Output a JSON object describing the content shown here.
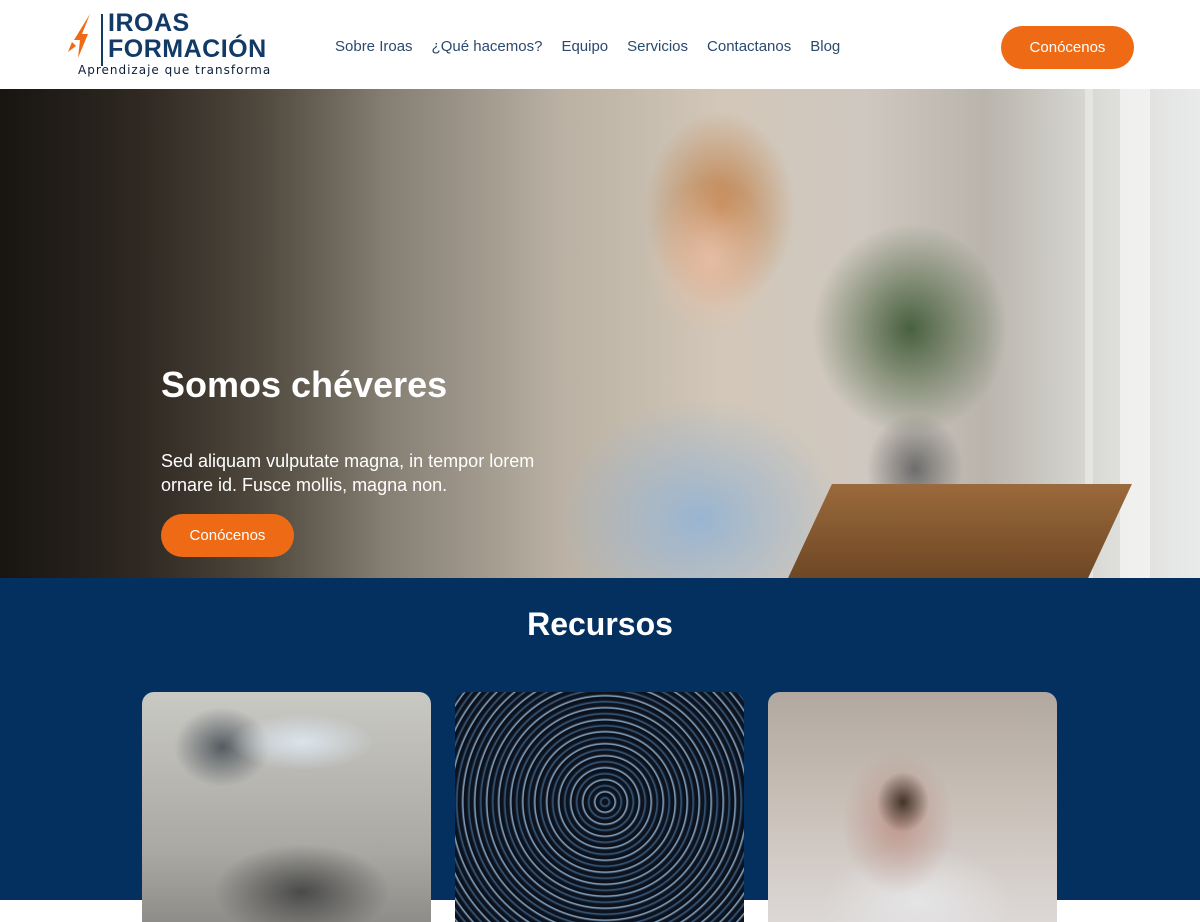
{
  "brand": {
    "line1": "IROAS",
    "line2": "FORMACIÓN",
    "tagline": "Aprendizaje que transforma",
    "accent_color": "#ee6a14",
    "primary_color": "#123a66"
  },
  "nav": {
    "items": [
      {
        "label": "Sobre Iroas"
      },
      {
        "label": "¿Qué hacemos?"
      },
      {
        "label": "Equipo"
      },
      {
        "label": "Servicios"
      },
      {
        "label": "Contactanos"
      },
      {
        "label": "Blog"
      }
    ],
    "cta_label": "Conócenos"
  },
  "hero": {
    "title": "Somos chéveres",
    "text": "Sed aliquam vulputate magna, in tempor lorem ornare id. Fusce mollis, magna non.",
    "cta_label": "Conócenos",
    "image": "smiling-woman-photo"
  },
  "resources": {
    "title": "Recursos",
    "background_color": "#03305e",
    "cards": [
      {
        "image": "blurred-abstract-photo"
      },
      {
        "image": "star-trails-photo"
      },
      {
        "image": "pug-in-blanket-photo"
      }
    ]
  }
}
